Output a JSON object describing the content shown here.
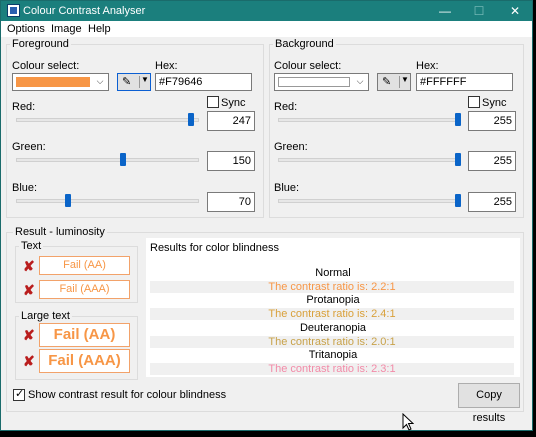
{
  "window": {
    "title": "Colour Contrast Analyser",
    "minimize_icon": "—",
    "maximize_icon": "☐",
    "close_icon": "✕"
  },
  "menu": [
    "Options",
    "Image",
    "Help"
  ],
  "foreground": {
    "group_label": "Foreground",
    "colour_select_label": "Colour select:",
    "hex_label": "Hex:",
    "hex_value": "#F79646",
    "swatch_color": "#F79646",
    "red_label": "Red:",
    "red": "247",
    "red_level": 0.969,
    "green_label": "Green:",
    "green": "150",
    "green_level": 0.588,
    "blue_label": "Blue:",
    "blue": "70",
    "blue_level": 0.275,
    "sync_label": "Sync"
  },
  "background": {
    "group_label": "Background",
    "colour_select_label": "Colour select:",
    "hex_label": "Hex:",
    "hex_value": "#FFFFFF",
    "swatch_color": "#FFFFFF",
    "red_label": "Red:",
    "red": "255",
    "red_level": 1.0,
    "green_label": "Green:",
    "green": "255",
    "green_level": 1.0,
    "blue_label": "Blue:",
    "blue": "255",
    "blue_level": 1.0,
    "sync_label": "Sync"
  },
  "result": {
    "group_label": "Result - luminosity",
    "text_label": "Text",
    "text_aa": "Fail (AA)",
    "text_aaa": "Fail (AAA)",
    "large_label": "Large text",
    "large_aa": "Fail (AA)",
    "large_aaa": "Fail (AAA)",
    "fail_icon": "✘"
  },
  "blindness": {
    "header": "Results for color blindness",
    "items": [
      {
        "title": "Normal",
        "ratio": "The contrast ratio is: 2.2:1",
        "color": "#F79646"
      },
      {
        "title": "Protanopia",
        "ratio": "The contrast ratio is: 2.4:1",
        "color": "#D9A03A"
      },
      {
        "title": "Deuteranopia",
        "ratio": "The contrast ratio is: 2.0:1",
        "color": "#C8A24A"
      },
      {
        "title": "Tritanopia",
        "ratio": "The contrast ratio is: 2.3:1",
        "color": "#F28BA8"
      }
    ]
  },
  "show_blindness_label": "Show contrast result for colour blindness",
  "copy_button": "Copy results"
}
